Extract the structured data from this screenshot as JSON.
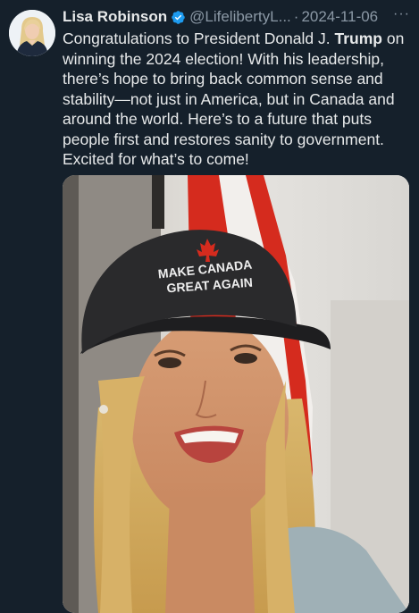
{
  "tweet": {
    "author_name": "Lisa Robinson",
    "handle": "@LifelibertyL...",
    "separator": "·",
    "date": "2024-11-06",
    "more_label": "···",
    "text_before": "Congratulations to President Donald J. ",
    "text_bold": "Trump",
    "text_after": " on winning the 2024 election! With his leadership, there’s hope to bring back common sense and stability—not just in America, but in Canada and around the world. Here’s to a future that puts people first and restores sanity to government. Excited for what’s to come!",
    "hat_text_line1": "MAKE CANADA",
    "hat_text_line2": "GREAT AGAIN"
  },
  "colors": {
    "background": "#15202b",
    "text": "#e7e9ea",
    "secondary": "#8b98a5",
    "verified_badge": "#1d9bf0",
    "flag_red": "#d52b1e"
  },
  "icons": {
    "verified": "verified-badge-icon",
    "more": "more-options-icon"
  }
}
